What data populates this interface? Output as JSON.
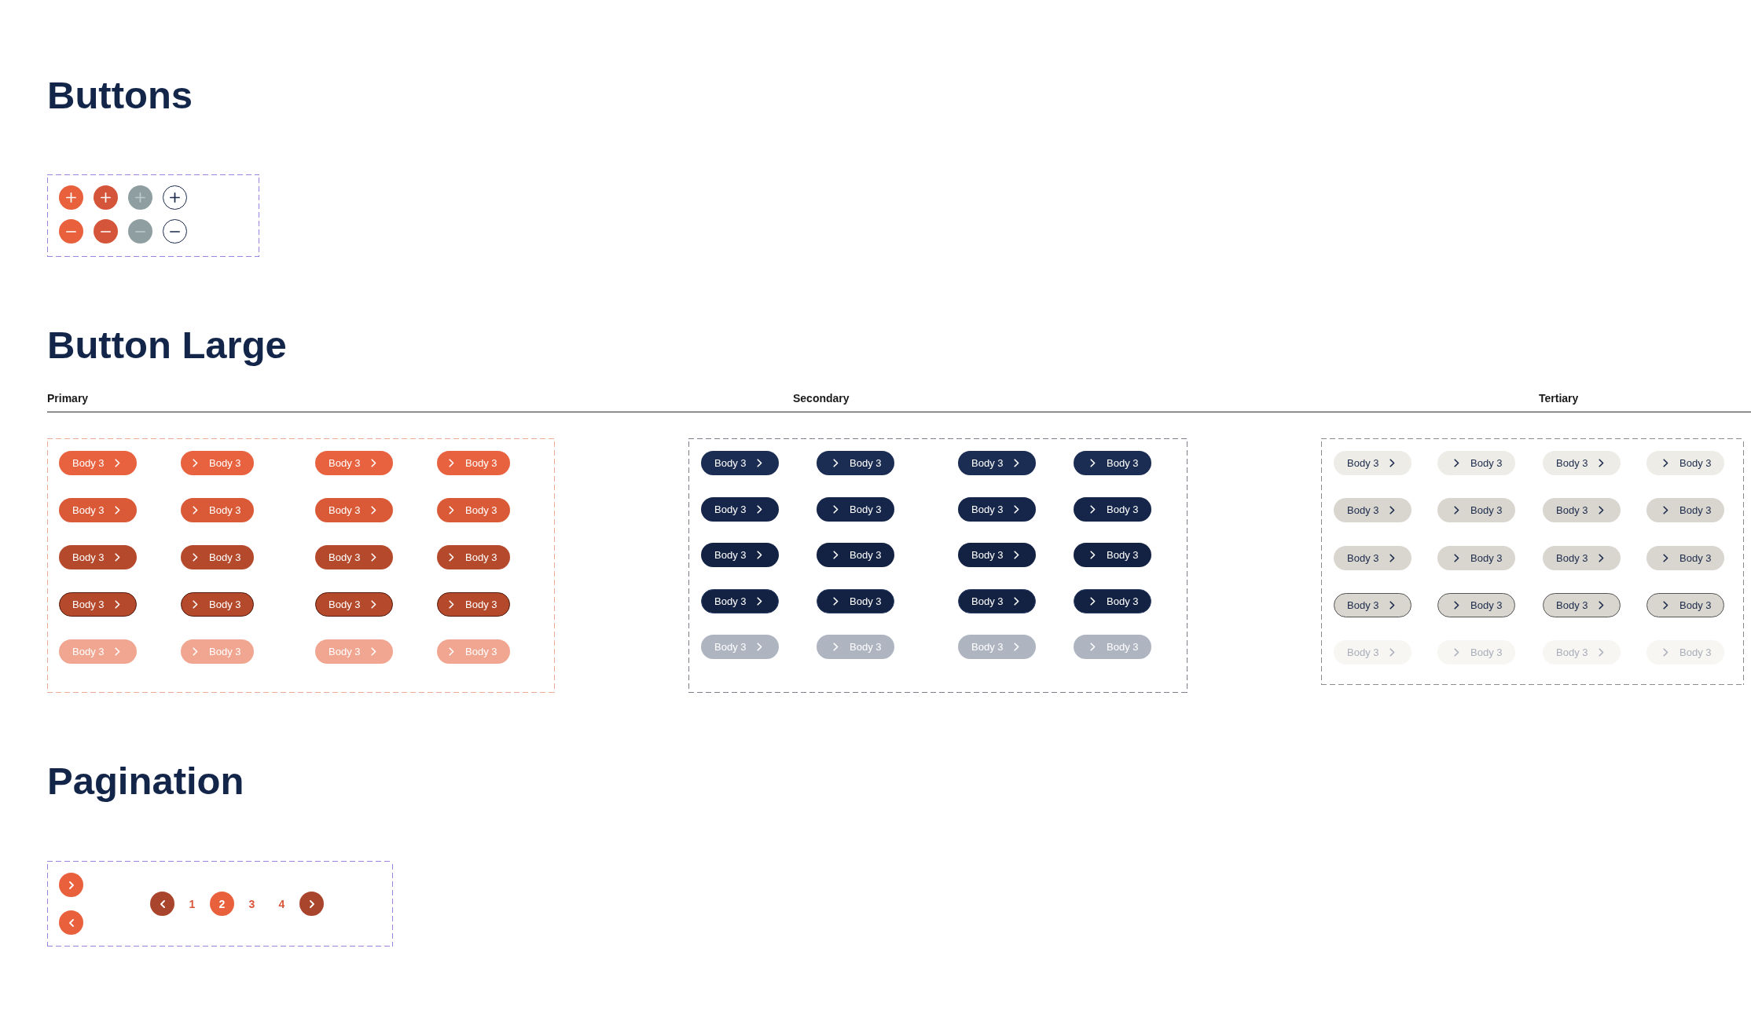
{
  "buttons": {
    "title": "Buttons",
    "rows": [
      {
        "kind": "plus",
        "buttons": [
          {
            "kind": "default"
          },
          {
            "kind": "hover"
          },
          {
            "kind": "disabled"
          },
          {
            "kind": "outline"
          }
        ]
      },
      {
        "kind": "minus",
        "buttons": [
          {
            "kind": "default"
          },
          {
            "kind": "hover"
          },
          {
            "kind": "disabled"
          },
          {
            "kind": "outline"
          }
        ]
      }
    ]
  },
  "button_large": {
    "title": "Button Large",
    "groups": [
      {
        "label": "Primary",
        "kind": "primary",
        "rows": [
          {
            "kind": "default",
            "buttons": [
              {
                "label": "Body 3",
                "kind": "trailing"
              },
              {
                "label": "Body 3",
                "kind": "leading"
              },
              {
                "label": "Body 3",
                "kind": "trailing"
              },
              {
                "label": "Body 3",
                "kind": "leading"
              }
            ]
          },
          {
            "kind": "hover",
            "buttons": [
              {
                "label": "Body 3",
                "kind": "trailing"
              },
              {
                "label": "Body 3",
                "kind": "leading"
              },
              {
                "label": "Body 3",
                "kind": "trailing"
              },
              {
                "label": "Body 3",
                "kind": "leading"
              }
            ]
          },
          {
            "kind": "pressed",
            "buttons": [
              {
                "label": "Body 3",
                "kind": "trailing"
              },
              {
                "label": "Body 3",
                "kind": "leading"
              },
              {
                "label": "Body 3",
                "kind": "trailing"
              },
              {
                "label": "Body 3",
                "kind": "leading"
              }
            ]
          },
          {
            "kind": "focus",
            "buttons": [
              {
                "label": "Body 3",
                "kind": "trailing"
              },
              {
                "label": "Body 3",
                "kind": "leading"
              },
              {
                "label": "Body 3",
                "kind": "trailing"
              },
              {
                "label": "Body 3",
                "kind": "leading"
              }
            ]
          },
          {
            "kind": "disabled",
            "buttons": [
              {
                "label": "Body 3",
                "kind": "trailing"
              },
              {
                "label": "Body 3",
                "kind": "leading"
              },
              {
                "label": "Body 3",
                "kind": "trailing"
              },
              {
                "label": "Body 3",
                "kind": "leading"
              }
            ]
          }
        ]
      },
      {
        "label": "Secondary",
        "kind": "secondary",
        "rows": [
          {
            "kind": "default",
            "buttons": [
              {
                "label": "Body 3",
                "kind": "trailing"
              },
              {
                "label": "Body 3",
                "kind": "leading"
              },
              {
                "label": "Body 3",
                "kind": "trailing"
              },
              {
                "label": "Body 3",
                "kind": "leading"
              }
            ]
          },
          {
            "kind": "hover",
            "buttons": [
              {
                "label": "Body 3",
                "kind": "trailing"
              },
              {
                "label": "Body 3",
                "kind": "leading"
              },
              {
                "label": "Body 3",
                "kind": "trailing"
              },
              {
                "label": "Body 3",
                "kind": "leading"
              }
            ]
          },
          {
            "kind": "pressed",
            "buttons": [
              {
                "label": "Body 3",
                "kind": "trailing"
              },
              {
                "label": "Body 3",
                "kind": "leading"
              },
              {
                "label": "Body 3",
                "kind": "trailing"
              },
              {
                "label": "Body 3",
                "kind": "leading"
              }
            ]
          },
          {
            "kind": "focus",
            "buttons": [
              {
                "label": "Body 3",
                "kind": "trailing"
              },
              {
                "label": "Body 3",
                "kind": "leading"
              },
              {
                "label": "Body 3",
                "kind": "trailing"
              },
              {
                "label": "Body 3",
                "kind": "leading"
              }
            ]
          },
          {
            "kind": "disabled",
            "buttons": [
              {
                "label": "Body 3",
                "kind": "trailing"
              },
              {
                "label": "Body 3",
                "kind": "leading"
              },
              {
                "label": "Body 3",
                "kind": "trailing"
              },
              {
                "label": "Body 3",
                "kind": "leading"
              }
            ]
          }
        ]
      },
      {
        "label": "Tertiary",
        "kind": "tertiary",
        "rows": [
          {
            "kind": "default",
            "buttons": [
              {
                "label": "Body 3",
                "kind": "trailing"
              },
              {
                "label": "Body 3",
                "kind": "leading"
              },
              {
                "label": "Body 3",
                "kind": "trailing"
              },
              {
                "label": "Body 3",
                "kind": "leading"
              }
            ]
          },
          {
            "kind": "hover",
            "buttons": [
              {
                "label": "Body 3",
                "kind": "trailing"
              },
              {
                "label": "Body 3",
                "kind": "leading"
              },
              {
                "label": "Body 3",
                "kind": "trailing"
              },
              {
                "label": "Body 3",
                "kind": "leading"
              }
            ]
          },
          {
            "kind": "pressed",
            "buttons": [
              {
                "label": "Body 3",
                "kind": "trailing"
              },
              {
                "label": "Body 3",
                "kind": "leading"
              },
              {
                "label": "Body 3",
                "kind": "trailing"
              },
              {
                "label": "Body 3",
                "kind": "leading"
              }
            ]
          },
          {
            "kind": "focus",
            "buttons": [
              {
                "label": "Body 3",
                "kind": "trailing"
              },
              {
                "label": "Body 3",
                "kind": "leading"
              },
              {
                "label": "Body 3",
                "kind": "trailing"
              },
              {
                "label": "Body 3",
                "kind": "leading"
              }
            ]
          },
          {
            "kind": "disabled",
            "buttons": [
              {
                "label": "Body 3",
                "kind": "trailing"
              },
              {
                "label": "Body 3",
                "kind": "leading"
              },
              {
                "label": "Body 3",
                "kind": "trailing"
              },
              {
                "label": "Body 3",
                "kind": "leading"
              }
            ]
          }
        ]
      }
    ]
  },
  "pagination": {
    "title": "Pagination",
    "arrow_buttons": [
      {
        "kind": "next"
      },
      {
        "kind": "previous"
      }
    ],
    "pages": [
      {
        "label": "1",
        "selected": false
      },
      {
        "label": "2",
        "selected": true
      },
      {
        "label": "3",
        "selected": false
      },
      {
        "label": "4",
        "selected": false
      }
    ]
  }
}
